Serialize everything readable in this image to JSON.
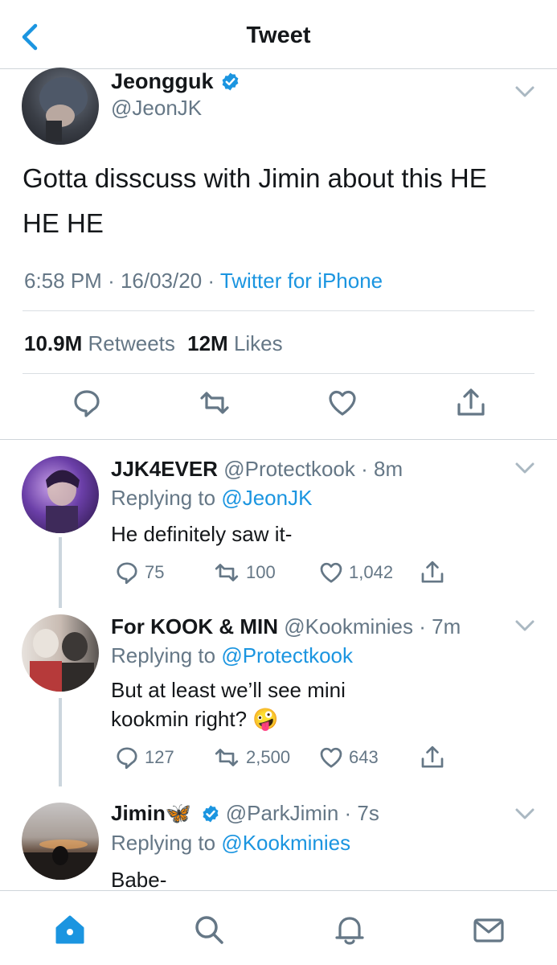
{
  "header": {
    "title": "Tweet",
    "back_icon": "chevron-left-icon"
  },
  "colors": {
    "accent": "#1b95e0",
    "text": "#14171a",
    "secondary": "#657786",
    "divider": "#dadfe3"
  },
  "main_tweet": {
    "name": "Jeongguk",
    "handle": "@JeonJK",
    "text": "Gotta disscuss with Jimin about this HE HE HE",
    "time": "6:58 PM",
    "date": "16/03/20",
    "source": "Twitter for iPhone",
    "retweets_count": "10.9M",
    "retweets_label": "Retweets",
    "likes_count": "12M",
    "likes_label": "Likes"
  },
  "replies": [
    {
      "name": "JJK4EVER",
      "handle": "@Protectkook",
      "time": "8m",
      "replying_prefix": "Replying to",
      "replying_to": "@JeonJK",
      "text": "He definitely saw it-",
      "replies": "75",
      "retweets": "100",
      "likes": "1,042"
    },
    {
      "name": "For KOOK & MIN",
      "handle": "@Kookminies",
      "time": "7m",
      "replying_prefix": "Replying to",
      "replying_to": "@Protectkook",
      "text": "But at least we’ll see mini kookmin right?",
      "emoji": "🤪",
      "replies": "127",
      "retweets": "2,500",
      "likes": "643"
    },
    {
      "name": "Jimin",
      "name_emoji": "🦋",
      "handle": "@ParkJimin",
      "time": "7s",
      "replying_prefix": "Replying to",
      "replying_to": "@Kookminies",
      "text": "Babe-"
    }
  ],
  "tabbar": {
    "items": [
      "home-icon",
      "search-icon",
      "notifications-icon",
      "messages-icon"
    ]
  }
}
